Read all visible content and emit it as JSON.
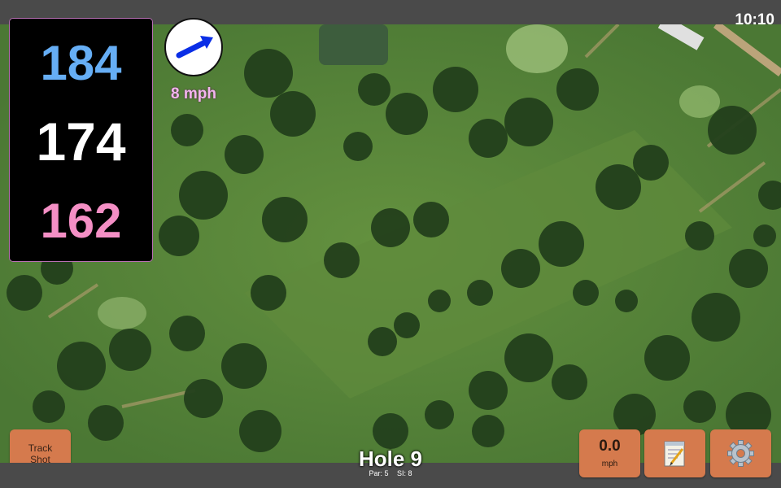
{
  "status_bar": {
    "time": "10:10"
  },
  "distances": {
    "back": "184",
    "center": "174",
    "front": "162"
  },
  "wind": {
    "speed_label": "8 mph",
    "icon": "wind-arrow-icon"
  },
  "buttons": {
    "track_shot_line1": "Track",
    "track_shot_line2": "Shot",
    "speed_value": "0.0",
    "speed_unit": "mph",
    "notes_icon": "notepad-icon",
    "settings_icon": "gear-icon"
  },
  "hole": {
    "title": "Hole 9",
    "par": "Par: 5",
    "si": "SI: 8"
  },
  "colors": {
    "back": "#66aef5",
    "center": "#ffffff",
    "front": "#f48fc5",
    "button": "#d57a4d",
    "wind_label": "#f3b5ee"
  }
}
